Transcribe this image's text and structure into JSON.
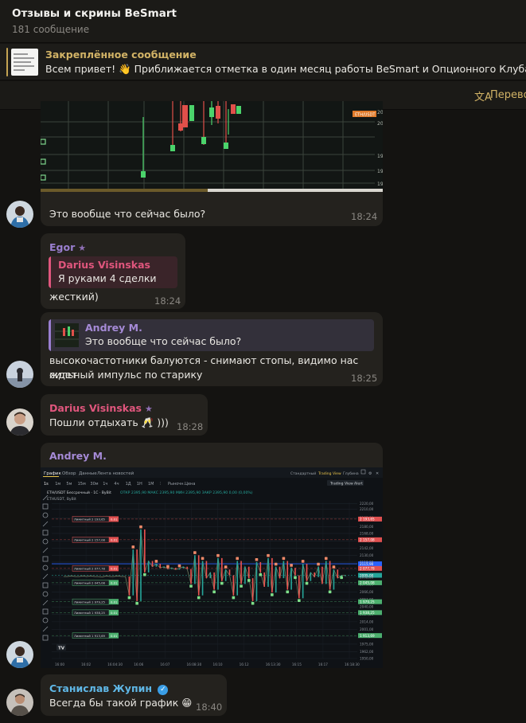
{
  "header": {
    "title": "Отзывы и скрины BeSmart",
    "subtitle": "181 сообщение"
  },
  "pinned": {
    "title": "Закреплённое сообщение",
    "text": "Всем привет! 👋 Приближается отметка в один месяц работы BeSmart и Опционного Клуба!  Мы"
  },
  "translate": {
    "icon": "文A",
    "label": "Перевод"
  },
  "messages": {
    "m1": {
      "image_badge": "ETH/USDT",
      "axis_labels": [
        "20",
        "20",
        "19",
        "19",
        "19"
      ],
      "text": "Это вообще что сейчас было?",
      "time": "18:24"
    },
    "m2": {
      "author": "Egor",
      "star": "★",
      "reply_author": "Darius Visinskas",
      "reply_text": "Я руками 4 сделки ус...",
      "text": "жесткий)",
      "time": "18:24"
    },
    "m3": {
      "reply_author": "Andrey M.",
      "reply_text": "Это вообще что сейчас было?",
      "text_line1": "высокочастотники балуются - снимают стопы, видимо нас ждет",
      "text_line2": "сильный импульс по старику",
      "time": "18:25"
    },
    "m4": {
      "author": "Darius Visinskas",
      "star": "★",
      "text": "Пошли отдыхать 🥂 )))",
      "time": "18:28"
    },
    "m5": {
      "author": "Andrey M."
    },
    "m6": {
      "author": "Станислав Жупин",
      "verified": "✓",
      "text": "Всегда бы такой график 😁",
      "time": "18:40"
    }
  },
  "chart_ui": {
    "tabs": [
      "График",
      "Обзор",
      "Данные",
      "Лента новостей"
    ],
    "right_links": [
      "Стандартный",
      "Trading View",
      "Глубина"
    ],
    "timeframes": [
      "1s",
      "1м",
      "5м",
      "15м",
      "30м",
      "1ч",
      "4ч",
      "1Д",
      "1Н",
      "1М"
    ],
    "alert_label": "Trading View Alert",
    "order_type_label": "Рыночн.Цена",
    "symbol_line": "ETH/USDT Бессрочный · 1С · ByBit",
    "ohlc_line": "ОТКР 2395,90  МАКС 2395,90  МИН 2395,90  ЗАКР 2395,90  0,00 (0,00%)",
    "ticker": "ETHUSDT, ByBit",
    "logo": "TV"
  },
  "chart_data": {
    "type": "line",
    "title": "ETH/USDT Бессрочный",
    "x_labels": [
      "16:00",
      "16:02",
      "16:04:30",
      "16:06",
      "16:07",
      "16:08:30",
      "16:10",
      "16:12",
      "16:13:30",
      "16:15",
      "16:17",
      "16:18:30"
    ],
    "ylim": [
      1950,
      2222
    ],
    "y_ticks": [
      2220.0,
      2210.0,
      2195.0,
      2180.0,
      2168.0,
      2155.0,
      2142.0,
      2130.0,
      2118.0,
      2105.0,
      2092.0,
      2079.0,
      2066.0,
      2053.0,
      2040.0,
      2027.0,
      2014.0,
      2001.0,
      1988.0,
      1975.0,
      1962.0,
      1950.0
    ],
    "y_tick_labels": [
      "2220,00",
      "2210,00",
      "2195,00",
      "2180,00",
      "2168,00",
      "2155,00",
      "2142,00",
      "2130,00",
      "2118,00",
      "2105,00",
      "2092,00",
      "2079,00",
      "2066,00",
      "2053,00",
      "2040,00",
      "2027,00",
      "2014,00",
      "2001,00",
      "1988,00",
      "1975,00",
      "1962,00",
      "1950,00"
    ],
    "current_price": 2095,
    "current_price_label": "2095,00",
    "ref_line": 2115,
    "ref_label": "2115,90",
    "series": [
      {
        "values": [
          2093,
          2093,
          2094,
          2093,
          2093,
          2094,
          2093,
          2094,
          2093,
          2093,
          2092,
          2094,
          2093,
          2093,
          2094,
          2093,
          2093,
          2060,
          2140,
          2050,
          2175,
          2100,
          2120,
          2110,
          2115,
          2108,
          2110,
          2106,
          2108,
          2105,
          2107,
          2110,
          2106,
          2080,
          2130,
          2060,
          2120,
          2090,
          2100,
          2070,
          2125,
          2085,
          2105,
          2095,
          2060,
          2120,
          2080,
          2110,
          2090,
          2050,
          2118,
          2100,
          2075,
          2125,
          2065,
          2110,
          2090,
          2120,
          2070,
          2108,
          2095,
          2055,
          2115,
          2085,
          2100,
          2092,
          2110,
          2080,
          2120,
          2070,
          2105,
          2090,
          2095,
          2095
        ]
      }
    ],
    "order_lines": [
      {
        "label": "Лимитный",
        "value": 2193,
        "qty": "2 193,65",
        "side": "sell"
      },
      {
        "label": "Лимитный",
        "value": 2157,
        "qty": "2 157,08",
        "side": "sell"
      },
      {
        "label": "Лимитный",
        "value": 2107,
        "qty": "2 077,78",
        "side": "sell"
      },
      {
        "label": "Лимитный",
        "value": 2082,
        "qty": "2 045,08",
        "side": "buy"
      },
      {
        "label": "Лимитный",
        "value": 2049,
        "qty": "1 979,25",
        "side": "buy"
      },
      {
        "label": "Лимитный",
        "value": 2030,
        "qty": "1 938,25",
        "side": "buy"
      },
      {
        "label": "Лимитный",
        "value": 1990,
        "qty": "1 913,69",
        "side": "buy"
      }
    ],
    "order_qty_badge": "0.01",
    "grid": true
  },
  "colors": {
    "accent": "#d2b366",
    "bubble": "#24221e",
    "egor": "#9a7fd0",
    "darius": "#e0567d",
    "andrey": "#9a7fd0",
    "stanislav": "#5fb7e6",
    "up": "#26a69a",
    "down": "#ef5350",
    "order_buy": "#4caf6e",
    "order_sell": "#e05050",
    "price_line": "#2962ff"
  }
}
